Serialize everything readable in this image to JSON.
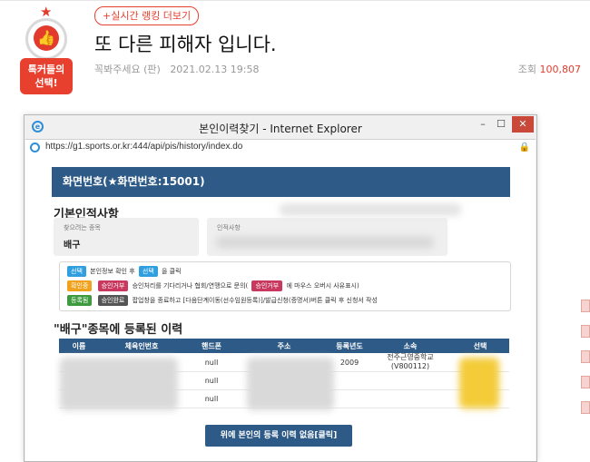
{
  "badge": {
    "line1": "톡커들의",
    "line2": "선택!"
  },
  "post": {
    "realtime_link": "+실시간 랭킹 더보기",
    "title": "또 다른 피해자 입니다.",
    "author": "꼭봐주세요 (판)",
    "date": "2021.02.13 19:58",
    "views_label": "조회",
    "views_value": "100,807"
  },
  "browser": {
    "title": "본인이력찾기 - Internet Explorer",
    "url": "https://g1.sports.or.kr:444/api/pis/history/index.do",
    "window_buttons": {
      "minimize": "–",
      "maximize": "☐",
      "close": "✕"
    }
  },
  "page": {
    "screen_no": "화면번호(★화면번호:15001)",
    "basic_section": "기본인적사항",
    "sport_label": "찾으려는 종목",
    "sport_value": "배구",
    "person_label": "인적사항",
    "legend": {
      "row1": {
        "tag1": "선택",
        "text1": "본인정보 확인 후",
        "tag2": "선택",
        "text2": "을 클릭"
      },
      "row2": {
        "tag1": "확인중",
        "tag2": "승인거부",
        "text1": "승인처리를 기다리거나 협회/연맹으로 문의(",
        "tag3": "승인거부",
        "text2": "에 마우스 오버시 사유표시)"
      },
      "row3": {
        "tag1": "등록됨",
        "tag2": "승인완료",
        "text1": "팝업창을 종료하고 [다음단계이동(선수임원등록)]/발급신청(증명서)버튼 클릭 후 신청서 작성"
      }
    },
    "history_section": "\"배구\"종목에 등록된 이력",
    "table": {
      "headers": [
        "이름",
        "체육인번호",
        "핸드폰",
        "주소",
        "등록년도",
        "소속",
        "선택"
      ],
      "rows": [
        {
          "phone": "null",
          "year": "2009",
          "org": "전주근영중학교 (V800112)"
        },
        {
          "phone": "null",
          "year": "",
          "org": ""
        },
        {
          "phone": "null",
          "year": "",
          "org": ""
        }
      ]
    },
    "register_button": "위에 본인의 등록 이력 없음[클릭]"
  },
  "colors": {
    "accent": "#e8402f",
    "primary": "#2d5a86"
  }
}
